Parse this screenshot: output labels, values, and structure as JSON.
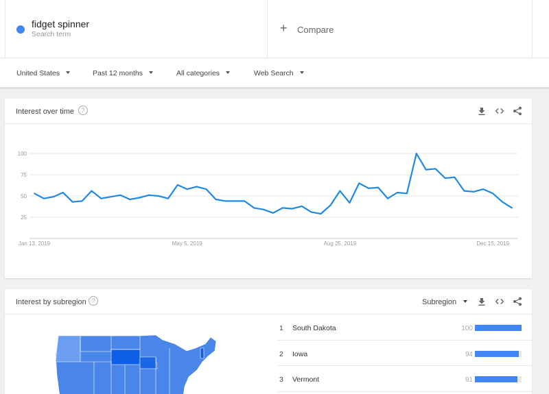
{
  "search_term": {
    "name": "fidget spinner",
    "label": "Search term",
    "color": "#4285f4"
  },
  "compare": {
    "label": "Compare",
    "icon": "plus-icon"
  },
  "filters": [
    {
      "label": "United States"
    },
    {
      "label": "Past 12 months"
    },
    {
      "label": "All categories"
    },
    {
      "label": "Web Search"
    }
  ],
  "interest_over_time": {
    "title": "Interest over time",
    "help_icon": "?",
    "actions": [
      "download-icon",
      "embed-icon",
      "share-icon"
    ]
  },
  "chart_data": {
    "type": "line",
    "title": "Interest over time",
    "xlabel": "",
    "ylabel": "",
    "ylim": [
      0,
      100
    ],
    "yticks": [
      25,
      50,
      75,
      100
    ],
    "xtick_labels": [
      "Jan 13, 2019",
      "May 5, 2019",
      "Aug 25, 2019",
      "Dec 15, 2019"
    ],
    "xtick_indices": [
      0,
      16,
      32,
      48
    ],
    "grid": true,
    "series": [
      {
        "name": "fidget spinner",
        "color": "#1e88e5",
        "values": [
          53,
          47,
          49,
          54,
          43,
          44,
          56,
          47,
          49,
          51,
          46,
          48,
          51,
          50,
          47,
          63,
          58,
          61,
          58,
          46,
          44,
          44,
          44,
          36,
          34,
          30,
          36,
          35,
          38,
          31,
          29,
          39,
          56,
          42,
          65,
          59,
          60,
          47,
          54,
          53,
          100,
          81,
          82,
          71,
          72,
          56,
          55,
          58,
          53,
          43,
          36
        ]
      }
    ]
  },
  "interest_by_subregion": {
    "title": "Interest by subregion",
    "help_icon": "?",
    "dropdown_label": "Subregion",
    "rows": [
      {
        "rank": "1",
        "name": "South Dakota",
        "value": "100",
        "fraction": 1.0
      },
      {
        "rank": "2",
        "name": "Iowa",
        "value": "94",
        "fraction": 0.94
      },
      {
        "rank": "3",
        "name": "Vermont",
        "value": "91",
        "fraction": 0.91
      }
    ]
  }
}
